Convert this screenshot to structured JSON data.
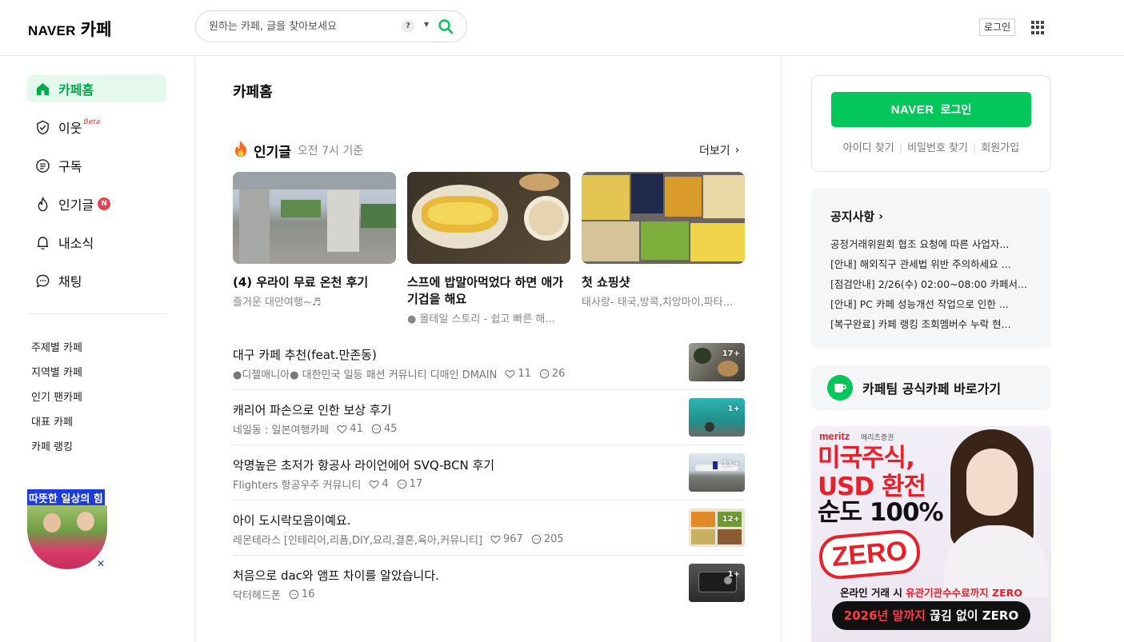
{
  "header": {
    "logo_brand": "NAVER",
    "logo_service": "카페",
    "search_placeholder": "원하는 카페, 글을 찾아보세요",
    "help_label": "?",
    "login_label": "로그인"
  },
  "sidebar": {
    "nav": [
      {
        "label": "카페홈",
        "icon": "home-icon",
        "active": true
      },
      {
        "label": "이웃",
        "icon": "check-badge-icon",
        "badge": "Beta"
      },
      {
        "label": "구독",
        "icon": "document-icon"
      },
      {
        "label": "인기글",
        "icon": "flame-icon",
        "badge": "N"
      },
      {
        "label": "내소식",
        "icon": "bell-icon"
      },
      {
        "label": "채팅",
        "icon": "chat-icon"
      }
    ],
    "links": [
      "주제별 카페",
      "지역별 카페",
      "인기 팬카페",
      "대표 카페",
      "카페 랭킹"
    ],
    "ad_label": "따뜻한 일상의 힘"
  },
  "main": {
    "page_title": "카페홈",
    "popular": {
      "title": "인기글",
      "basis": "오전 7시 기준",
      "more_label": "더보기"
    },
    "cards": [
      {
        "title": "(4) 우라이 무료 온천 후기",
        "cafe": "즐거운 대만여행~♬"
      },
      {
        "title": "스프에 밥말아먹었다 하면 애가 기겁을 해요",
        "cafe": "● 몰테일 스토리 - 쉽고 빠른 해..."
      },
      {
        "title": "첫 쇼핑샷",
        "cafe": "태사랑- 태국,방콕,치앙마이,파타..."
      }
    ],
    "list": [
      {
        "title": "대구 카페 추천(feat.만존동)",
        "cafe": "●디젤매니아● 대한민국 일등 패션 커뮤니티 디매인 DMAIN",
        "likes": "11",
        "comments": "26",
        "thumb_count": "17+"
      },
      {
        "title": "캐리어 파손으로 인한 보상 후기",
        "cafe": "네일동 : 일본여행카페",
        "likes": "41",
        "comments": "45",
        "thumb_count": "1+"
      },
      {
        "title": "악명높은 초저가 항공사 라이언에어 SVQ-BCN 후기",
        "cafe": "Flighters 항공우주 커뮤니티",
        "likes": "4",
        "comments": "17",
        "thumb_count": "11+"
      },
      {
        "title": "아이 도시락모음이예요.",
        "cafe": "레몬테라스 [인테리어,리폼,DIY,요리,결혼,육아,커뮤니티]",
        "likes": "967",
        "comments": "205",
        "thumb_count": "12+"
      },
      {
        "title": "처음으로 dac와 앰프 차이를 알았습니다.",
        "cafe": "닥터헤드폰",
        "likes": "",
        "comments": "16",
        "thumb_count": "1+"
      }
    ]
  },
  "right": {
    "login": {
      "brand": "NAVER",
      "label": "로그인",
      "links": [
        "아이디 찾기",
        "비밀번호 찾기",
        "회원가입"
      ]
    },
    "notice": {
      "title": "공지사항",
      "items": [
        "공정거래위원회 협조 요청에 따른 사업자...",
        "[안내] 해외직구 관세법 위반 주의하세요 ...",
        "[점검안내] 2/26(수) 02:00~08:00 카페서...",
        "[안내] PC 카페 성능개선 작업으로 인한 ...",
        "[복구완료] 카페 랭킹 조회멤버수 누락 현..."
      ]
    },
    "team_label": "카페팀 공식카페 바로가기",
    "ad": {
      "brand": "meritz",
      "brand_sub": "메리츠증권",
      "line_a": "미국주식,",
      "line_b": "USD 환전",
      "line_c": "순도 100%",
      "zero": "ZERO",
      "caption_prefix": "온라인 거래 시 ",
      "caption_highlight": "유관기관수수료까지 ZERO",
      "pill_highlight": "2026년 말까지",
      "pill_rest": " 끊김 없이 ZERO"
    }
  },
  "colors": {
    "brand_green": "#03c75a",
    "active_bg": "#e5f8ed",
    "badge_red": "#e8414b",
    "ad_red": "#e8202a"
  }
}
